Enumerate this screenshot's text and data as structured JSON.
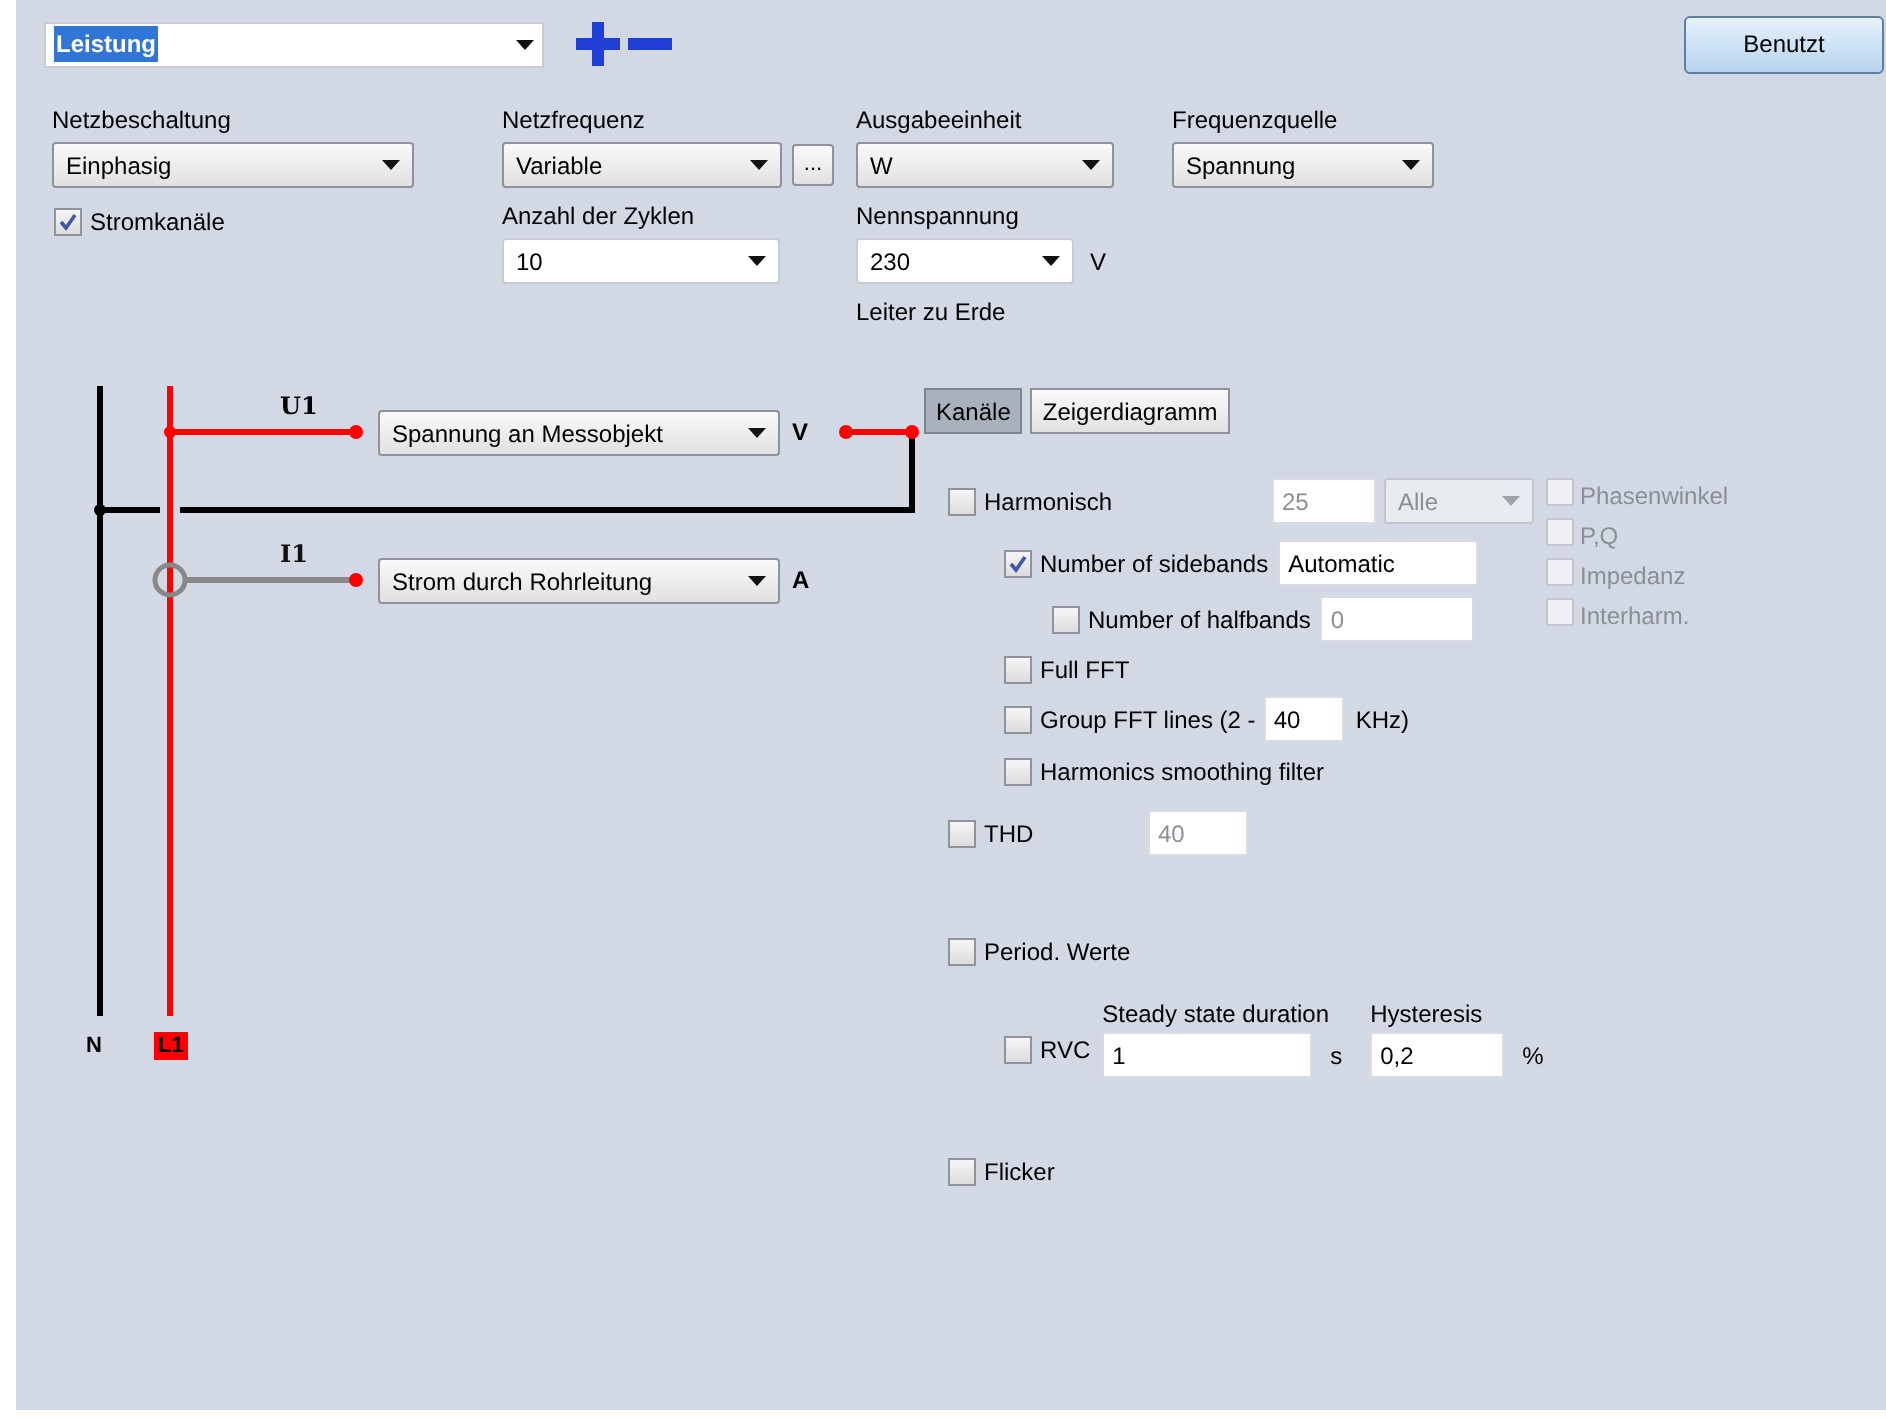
{
  "preset": {
    "value": "Leistung"
  },
  "apply_button": "Benutzt",
  "netzbeschaltung": {
    "label": "Netzbeschaltung",
    "value": "Einphasig"
  },
  "stromkanaele": {
    "label": "Stromkanäle",
    "checked": true
  },
  "netzfrequenz": {
    "label": "Netzfrequenz",
    "value": "Variable",
    "more": "..."
  },
  "zyklen": {
    "label": "Anzahl der Zyklen",
    "value": "10"
  },
  "ausgabeeinheit": {
    "label": "Ausgabeeinheit",
    "value": "W"
  },
  "nennspannung": {
    "label": "Nennspannung",
    "value": "230",
    "unit": "V",
    "note": "Leiter zu Erde"
  },
  "frequenzquelle": {
    "label": "Frequenzquelle",
    "value": "Spannung"
  },
  "diagram": {
    "channels": [
      {
        "name": "U1",
        "kind": "voltage",
        "source": "Spannung an Messobjekt",
        "unit": "V"
      },
      {
        "name": "I1",
        "kind": "current",
        "source": "Strom durch Rohrleitung",
        "unit": "A"
      }
    ],
    "conductors": [
      {
        "label": "N",
        "kind": "neutral"
      },
      {
        "label": "L1",
        "kind": "phase"
      }
    ]
  },
  "tabs": [
    {
      "label": "Kanäle",
      "selected": true
    },
    {
      "label": "Zeigerdiagramm",
      "selected": false
    }
  ],
  "harmonisch": {
    "label": "Harmonisch",
    "checked": false,
    "order": "25",
    "mode": "Alle",
    "disabled": true
  },
  "side_options": [
    {
      "label": "Phasenwinkel",
      "checked": false,
      "disabled": true
    },
    {
      "label": "P,Q",
      "checked": false,
      "disabled": true
    },
    {
      "label": "Impedanz",
      "checked": false,
      "disabled": true
    },
    {
      "label": "Interharm.",
      "checked": false,
      "disabled": true
    }
  ],
  "sidebands": {
    "label": "Number of sidebands",
    "checked": true,
    "value": "Automatic"
  },
  "halfbands": {
    "label": "Number of halfbands",
    "checked": false,
    "value": "0",
    "disabled": true
  },
  "full_fft": {
    "label": "Full FFT",
    "checked": false
  },
  "group_fft": {
    "label": "Group FFT lines (2 -",
    "checked": false,
    "value": "40",
    "unit": "KHz)"
  },
  "smoothing": {
    "label": "Harmonics smoothing filter",
    "checked": false
  },
  "thd": {
    "label": "THD",
    "checked": false,
    "value": "40",
    "disabled": true
  },
  "period": {
    "label": "Period. Werte",
    "checked": false
  },
  "rvc": {
    "label": "RVC",
    "checked": false,
    "duration_label": "Steady state duration",
    "duration": "1",
    "duration_unit": "s",
    "hysteresis_label": "Hysteresis",
    "hysteresis": "0,2",
    "hysteresis_unit": "%"
  },
  "flicker": {
    "label": "Flicker",
    "checked": false
  }
}
